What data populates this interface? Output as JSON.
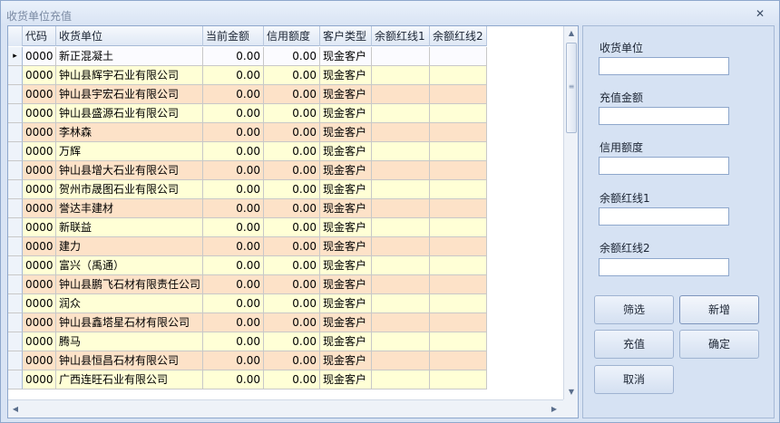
{
  "window": {
    "title": "收货单位充值",
    "close_glyph": "✕"
  },
  "grid": {
    "columns": [
      "代码",
      "收货单位",
      "当前金额",
      "信用额度",
      "客户类型",
      "余额红线1",
      "余额红线2"
    ],
    "current_row_marker": "▸",
    "rows": [
      {
        "code": "0000",
        "name": "新正混凝土",
        "balance": "0.00",
        "credit": "0.00",
        "type": "现金客户",
        "red1": "",
        "red2": ""
      },
      {
        "code": "0000",
        "name": "钟山县辉宇石业有限公司",
        "balance": "0.00",
        "credit": "0.00",
        "type": "现金客户",
        "red1": "",
        "red2": ""
      },
      {
        "code": "0000",
        "name": "钟山县宇宏石业有限公司",
        "balance": "0.00",
        "credit": "0.00",
        "type": "现金客户",
        "red1": "",
        "red2": ""
      },
      {
        "code": "0000",
        "name": "钟山县盛源石业有限公司",
        "balance": "0.00",
        "credit": "0.00",
        "type": "现金客户",
        "red1": "",
        "red2": ""
      },
      {
        "code": "0000",
        "name": "李林森",
        "balance": "0.00",
        "credit": "0.00",
        "type": "现金客户",
        "red1": "",
        "red2": ""
      },
      {
        "code": "0000",
        "name": "万辉",
        "balance": "0.00",
        "credit": "0.00",
        "type": "现金客户",
        "red1": "",
        "red2": ""
      },
      {
        "code": "0000",
        "name": "钟山县增大石业有限公司",
        "balance": "0.00",
        "credit": "0.00",
        "type": "现金客户",
        "red1": "",
        "red2": ""
      },
      {
        "code": "0000",
        "name": "贺州市晟图石业有限公司",
        "balance": "0.00",
        "credit": "0.00",
        "type": "现金客户",
        "red1": "",
        "red2": ""
      },
      {
        "code": "0000",
        "name": "誉达丰建材",
        "balance": "0.00",
        "credit": "0.00",
        "type": "现金客户",
        "red1": "",
        "red2": ""
      },
      {
        "code": "0000",
        "name": "新联益",
        "balance": "0.00",
        "credit": "0.00",
        "type": "现金客户",
        "red1": "",
        "red2": ""
      },
      {
        "code": "0000",
        "name": "建力",
        "balance": "0.00",
        "credit": "0.00",
        "type": "现金客户",
        "red1": "",
        "red2": ""
      },
      {
        "code": "0000",
        "name": "富兴（禹通）",
        "balance": "0.00",
        "credit": "0.00",
        "type": "现金客户",
        "red1": "",
        "red2": ""
      },
      {
        "code": "0000",
        "name": "钟山县鹏飞石材有限责任公司",
        "balance": "0.00",
        "credit": "0.00",
        "type": "现金客户",
        "red1": "",
        "red2": ""
      },
      {
        "code": "0000",
        "name": "润众",
        "balance": "0.00",
        "credit": "0.00",
        "type": "现金客户",
        "red1": "",
        "red2": ""
      },
      {
        "code": "0000",
        "name": "钟山县鑫塔星石材有限公司",
        "balance": "0.00",
        "credit": "0.00",
        "type": "现金客户",
        "red1": "",
        "red2": ""
      },
      {
        "code": "0000",
        "name": "腾马",
        "balance": "0.00",
        "credit": "0.00",
        "type": "现金客户",
        "red1": "",
        "red2": ""
      },
      {
        "code": "0000",
        "name": "钟山县恒昌石材有限公司",
        "balance": "0.00",
        "credit": "0.00",
        "type": "现金客户",
        "red1": "",
        "red2": ""
      },
      {
        "code": "0000",
        "name": "广西连旺石业有限公司",
        "balance": "0.00",
        "credit": "0.00",
        "type": "现金客户",
        "red1": "",
        "red2": ""
      }
    ]
  },
  "form": {
    "receiver_label": "收货单位",
    "receiver_value": "",
    "amount_label": "充值金额",
    "amount_value": "",
    "credit_label": "信用额度",
    "credit_value": "",
    "red1_label": "余额红线1",
    "red1_value": "",
    "red2_label": "余额红线2",
    "red2_value": ""
  },
  "buttons": {
    "filter": "筛选",
    "add": "新增",
    "recharge": "充值",
    "confirm": "确定",
    "cancel": "取消"
  },
  "scroll_glyphs": {
    "up": "▲",
    "down": "▼",
    "left": "◀",
    "right": "▶",
    "grip": "≡"
  }
}
